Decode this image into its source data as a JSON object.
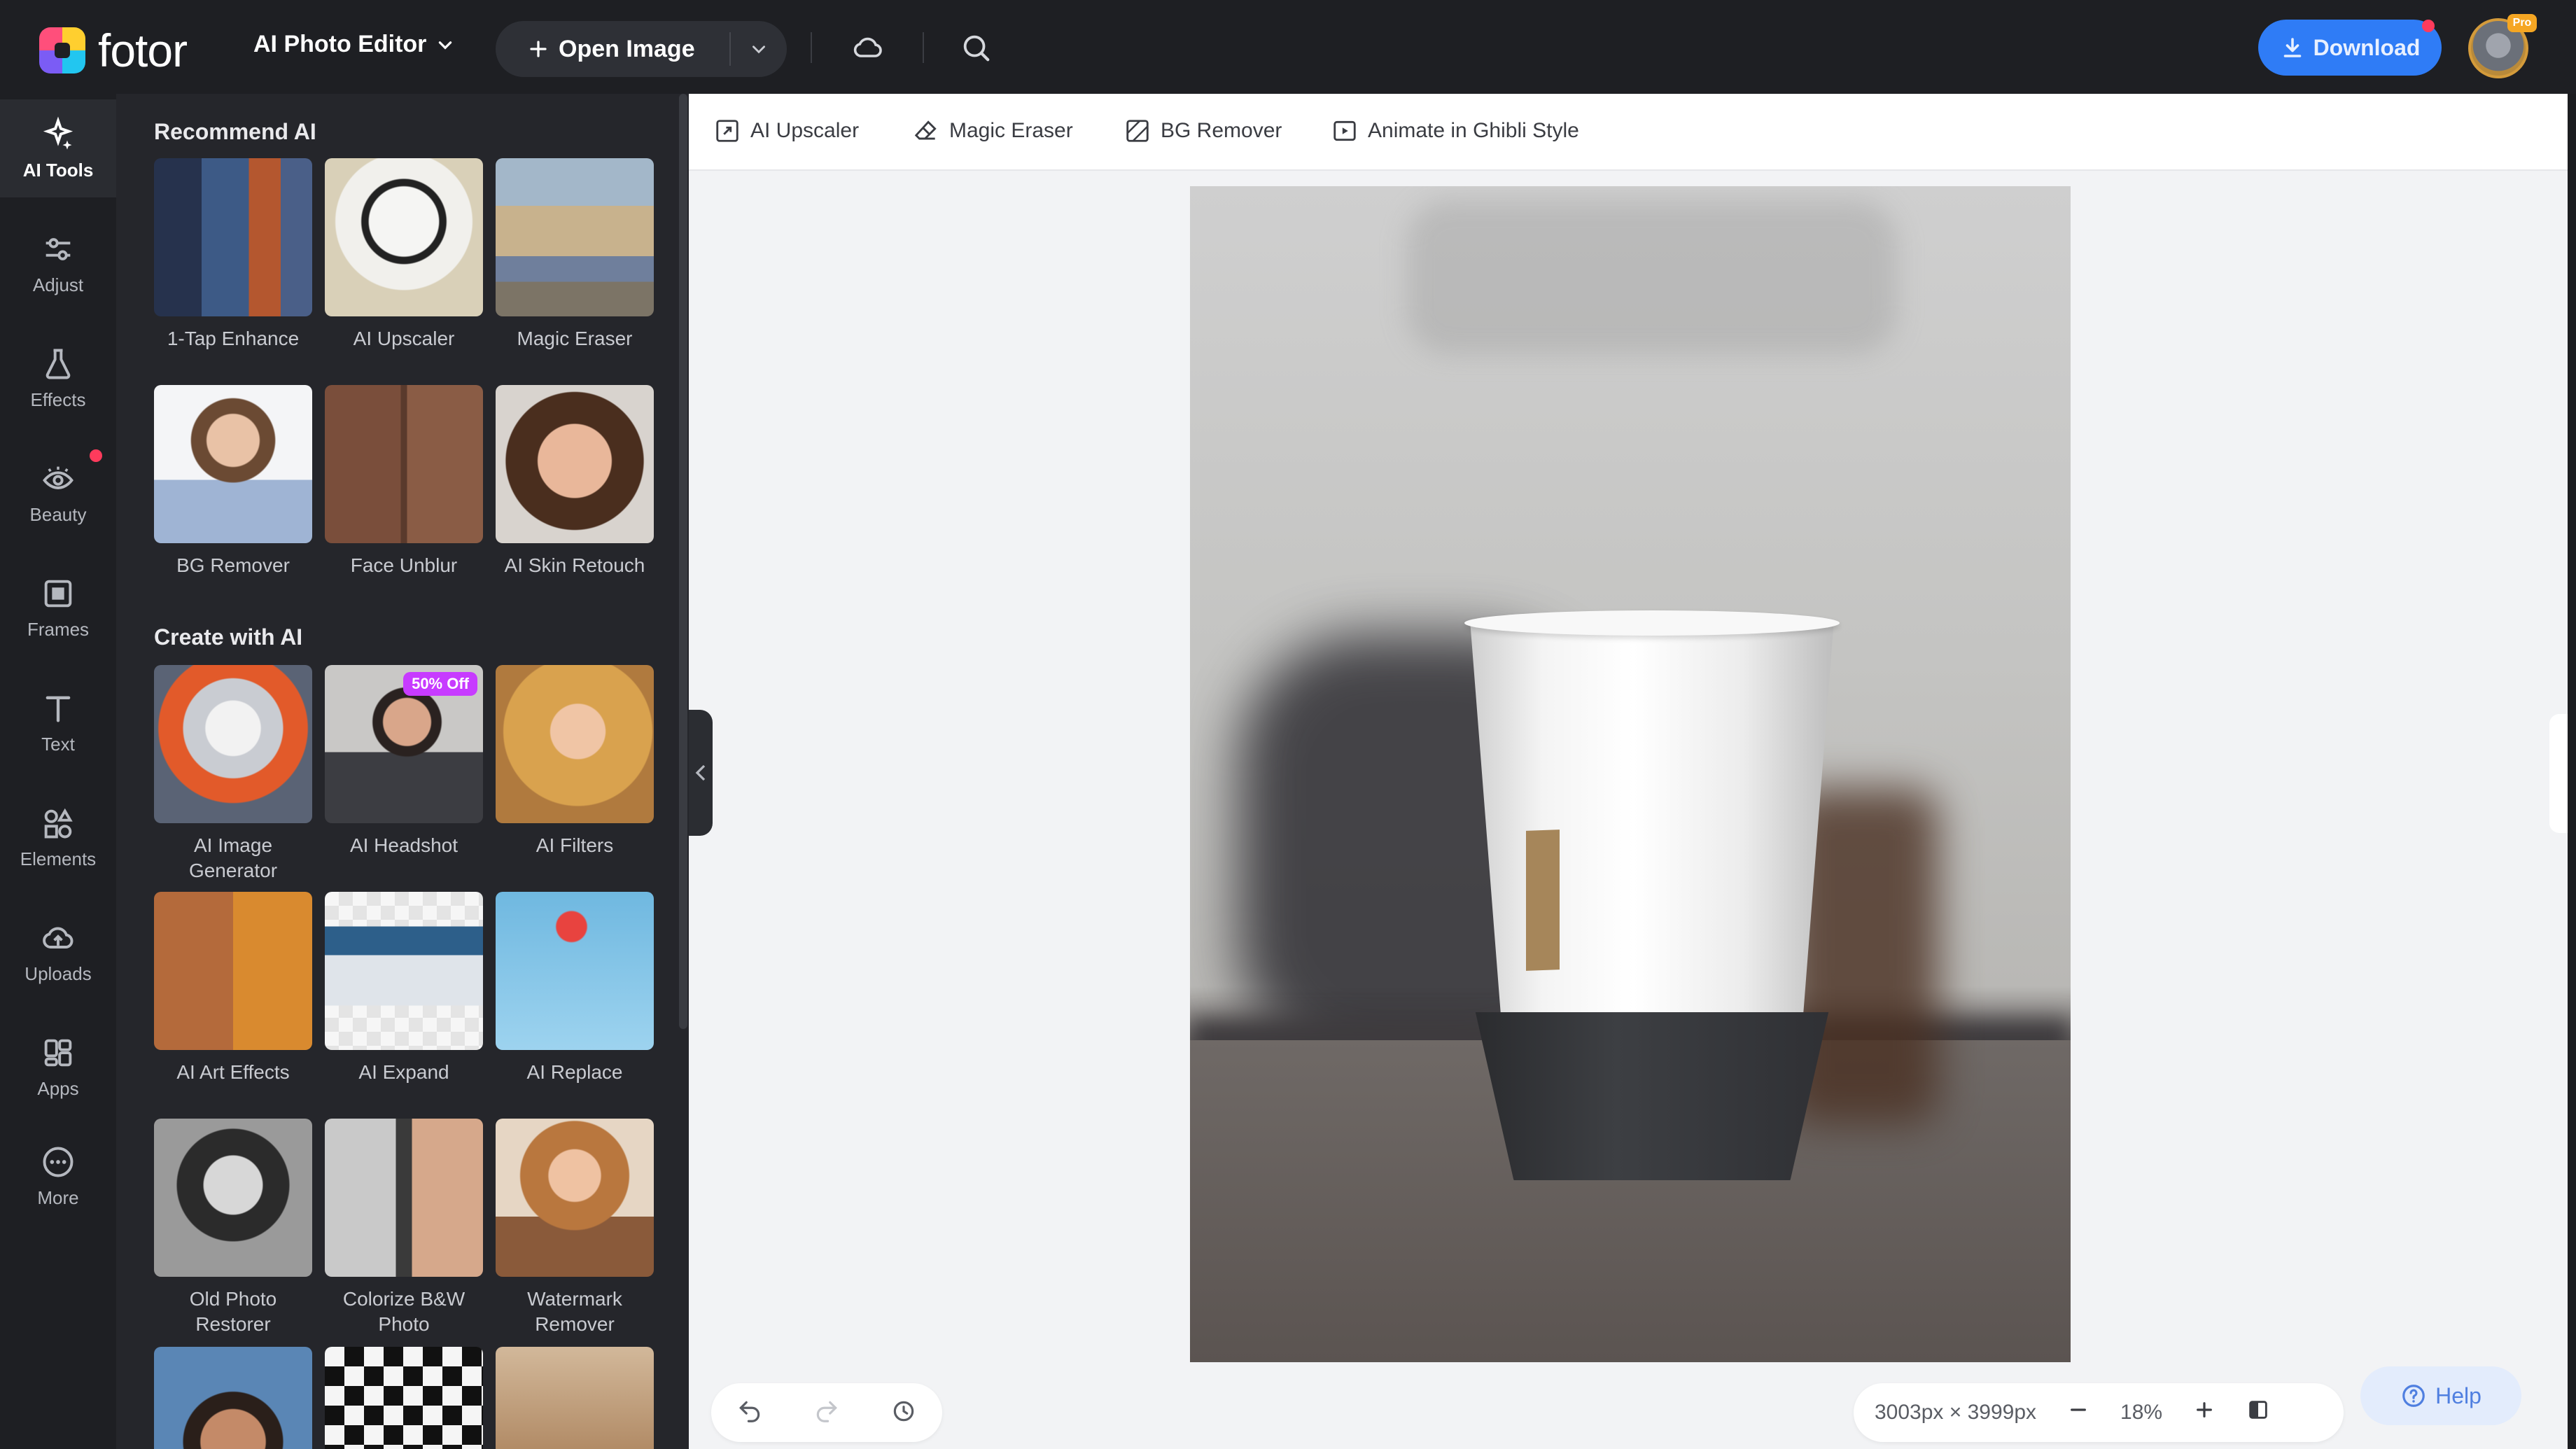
{
  "brand": {
    "name": "fotor"
  },
  "header": {
    "editor_mode": "AI Photo Editor",
    "open_image_label": "Open Image",
    "download_label": "Download",
    "pro_badge": "Pro"
  },
  "rail": {
    "items": [
      {
        "label": "AI Tools",
        "icon": "sparkle-icon",
        "active": true
      },
      {
        "label": "Adjust",
        "icon": "sliders-icon"
      },
      {
        "label": "Effects",
        "icon": "flask-icon"
      },
      {
        "label": "Beauty",
        "icon": "eye-icon"
      },
      {
        "label": "Frames",
        "icon": "frame-icon"
      },
      {
        "label": "Text",
        "icon": "text-icon"
      },
      {
        "label": "Elements",
        "icon": "shapes-icon"
      },
      {
        "label": "Uploads",
        "icon": "cloud-upload-icon"
      },
      {
        "label": "Apps",
        "icon": "apps-icon"
      },
      {
        "label": "More",
        "icon": "more-icon"
      }
    ]
  },
  "panel": {
    "recommend_heading": "Recommend AI",
    "create_heading": "Create with AI",
    "recommend": [
      {
        "label": "1-Tap Enhance"
      },
      {
        "label": "AI Upscaler"
      },
      {
        "label": "Magic Eraser"
      },
      {
        "label": "BG Remover"
      },
      {
        "label": "Face Unblur"
      },
      {
        "label": "AI Skin Retouch"
      }
    ],
    "create": [
      {
        "label": "AI Image Generator"
      },
      {
        "label": "AI Headshot",
        "badge": "50% Off"
      },
      {
        "label": "AI Filters"
      },
      {
        "label": "AI Art Effects"
      },
      {
        "label": "AI Expand"
      },
      {
        "label": "AI Replace"
      },
      {
        "label": "Old Photo Restorer"
      },
      {
        "label": "Colorize B&W Photo"
      },
      {
        "label": "Watermark Remover"
      }
    ]
  },
  "subtoolbar": {
    "items": [
      {
        "label": "AI Upscaler",
        "icon": "upscale-icon"
      },
      {
        "label": "Magic Eraser",
        "icon": "eraser-icon"
      },
      {
        "label": "BG Remover",
        "icon": "bg-remove-icon"
      },
      {
        "label": "Animate in Ghibli Style",
        "icon": "animate-icon"
      }
    ]
  },
  "canvas": {
    "dimensions": "3003px × 3999px",
    "zoom": "18%"
  },
  "help_label": "Help",
  "colors": {
    "accent": "#2f7cf6",
    "panel": "#25262b",
    "workspace": "#f2f3f5"
  }
}
